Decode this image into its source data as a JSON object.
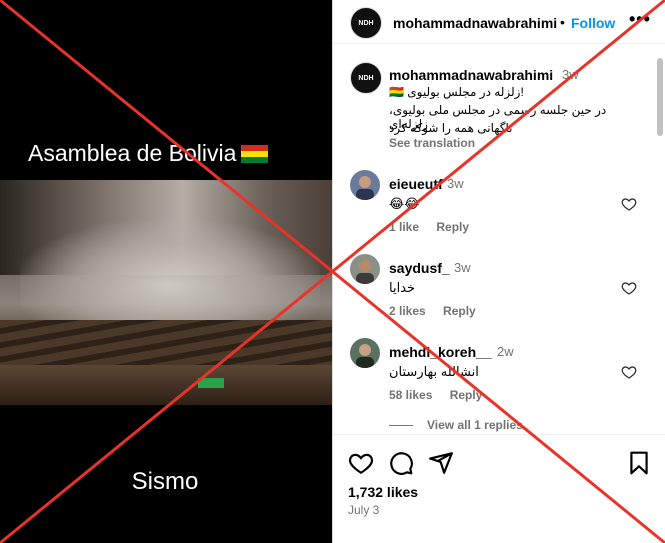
{
  "media": {
    "caption_top": "Asamblea de Bolivia",
    "caption_bottom": "Sismo",
    "flag_icon": "bolivia-flag-icon"
  },
  "header": {
    "handle": "mohammadnawabrahimi",
    "separator": "•",
    "follow_label": "Follow",
    "more_label": "•••",
    "avatar_text": "NDH"
  },
  "post": {
    "author": "mohammadnawabrahimi",
    "time": "3w",
    "line1": "!زلزله در مجلس بولیوی 🇧🇴",
    "line2": "در حین جلسه رسمی در مجلس ملی بولیوی، زلزله‌ای",
    "line3": "ناگهانی همه را شوکه کرد",
    "see_translation": "See translation"
  },
  "comments": [
    {
      "user": "eieueutf",
      "time": "3w",
      "text": "😂😂",
      "likes": "1 like",
      "reply": "Reply"
    },
    {
      "user": "saydusf_",
      "time": "3w",
      "text": "خدایا",
      "likes": "2 likes",
      "reply": "Reply"
    },
    {
      "user": "mehdi_koreh__",
      "time": "2w",
      "text": "انشالله بهارستان",
      "likes": "58 likes",
      "reply": "Reply"
    }
  ],
  "view_replies": "View all 1 replies",
  "footer": {
    "likes": "1,732 likes",
    "date": "July 3"
  },
  "colors": {
    "accent": "#0095f6",
    "muted": "#737373",
    "overlay_x": "#e8332a"
  }
}
